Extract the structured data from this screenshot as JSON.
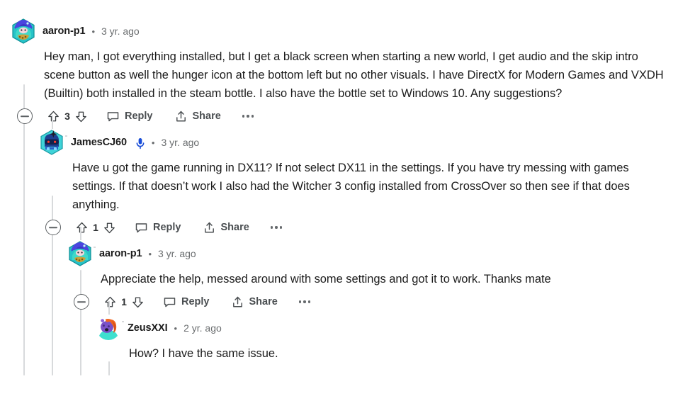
{
  "colors": {
    "text": "#1c1c1c",
    "meta": "#6a6d6f",
    "action": "#4a4e51",
    "thread_line": "#d8dadc",
    "mic_blue": "#1a4ed8"
  },
  "action_labels": {
    "reply": "Reply",
    "share": "Share",
    "collapse_title": "Collapse thread",
    "more_title": "More options"
  },
  "icons": {
    "collapse": "circle-minus-icon",
    "upvote": "upvote-arrow-icon",
    "downvote": "downvote-arrow-icon",
    "reply": "comment-bubble-icon",
    "share": "share-arrow-icon",
    "more": "overflow-dots-icon",
    "op_badge": "microphone-icon"
  },
  "comments": [
    {
      "id": "c1",
      "depth": 0,
      "author": "aaron-p1",
      "avatar": "hexagon-blue-gnome-avatar",
      "has_mic_badge": false,
      "separator": "•",
      "timestamp": "3 yr. ago",
      "body": "Hey man, I got everything installed, but I get a black screen when starting a new world, I get audio and the skip intro scene button as well the hunger icon at the bottom left but no other visuals. I have DirectX for Modern Games and VXDH (Builtin) both installed in the steam bottle. I also have the bottle set to Windows 10. Any suggestions?",
      "score": "3"
    },
    {
      "id": "c2",
      "depth": 1,
      "author": "JamesCJ60",
      "avatar": "hexagon-blue-robot-avatar",
      "has_mic_badge": true,
      "separator": "•",
      "timestamp": "3 yr. ago",
      "body": "Have u got the game running in DX11? If not select DX11 in the settings. If you have try messing with games settings. If that doesn’t work I also had the Witcher 3 config installed from CrossOver so then see if that does anything.",
      "score": "1"
    },
    {
      "id": "c3",
      "depth": 2,
      "author": "aaron-p1",
      "avatar": "hexagon-blue-gnome-avatar",
      "has_mic_badge": false,
      "separator": "•",
      "timestamp": "3 yr. ago",
      "body": "Appreciate the help, messed around with some settings and got it to work. Thanks mate",
      "score": "1"
    },
    {
      "id": "c4",
      "depth": 3,
      "author": "ZeusXXI",
      "avatar": "circle-purple-orange-hair-avatar",
      "has_mic_badge": false,
      "separator": "•",
      "timestamp": "2 yr. ago",
      "body": "How? I have the same issue.",
      "score": ""
    }
  ]
}
